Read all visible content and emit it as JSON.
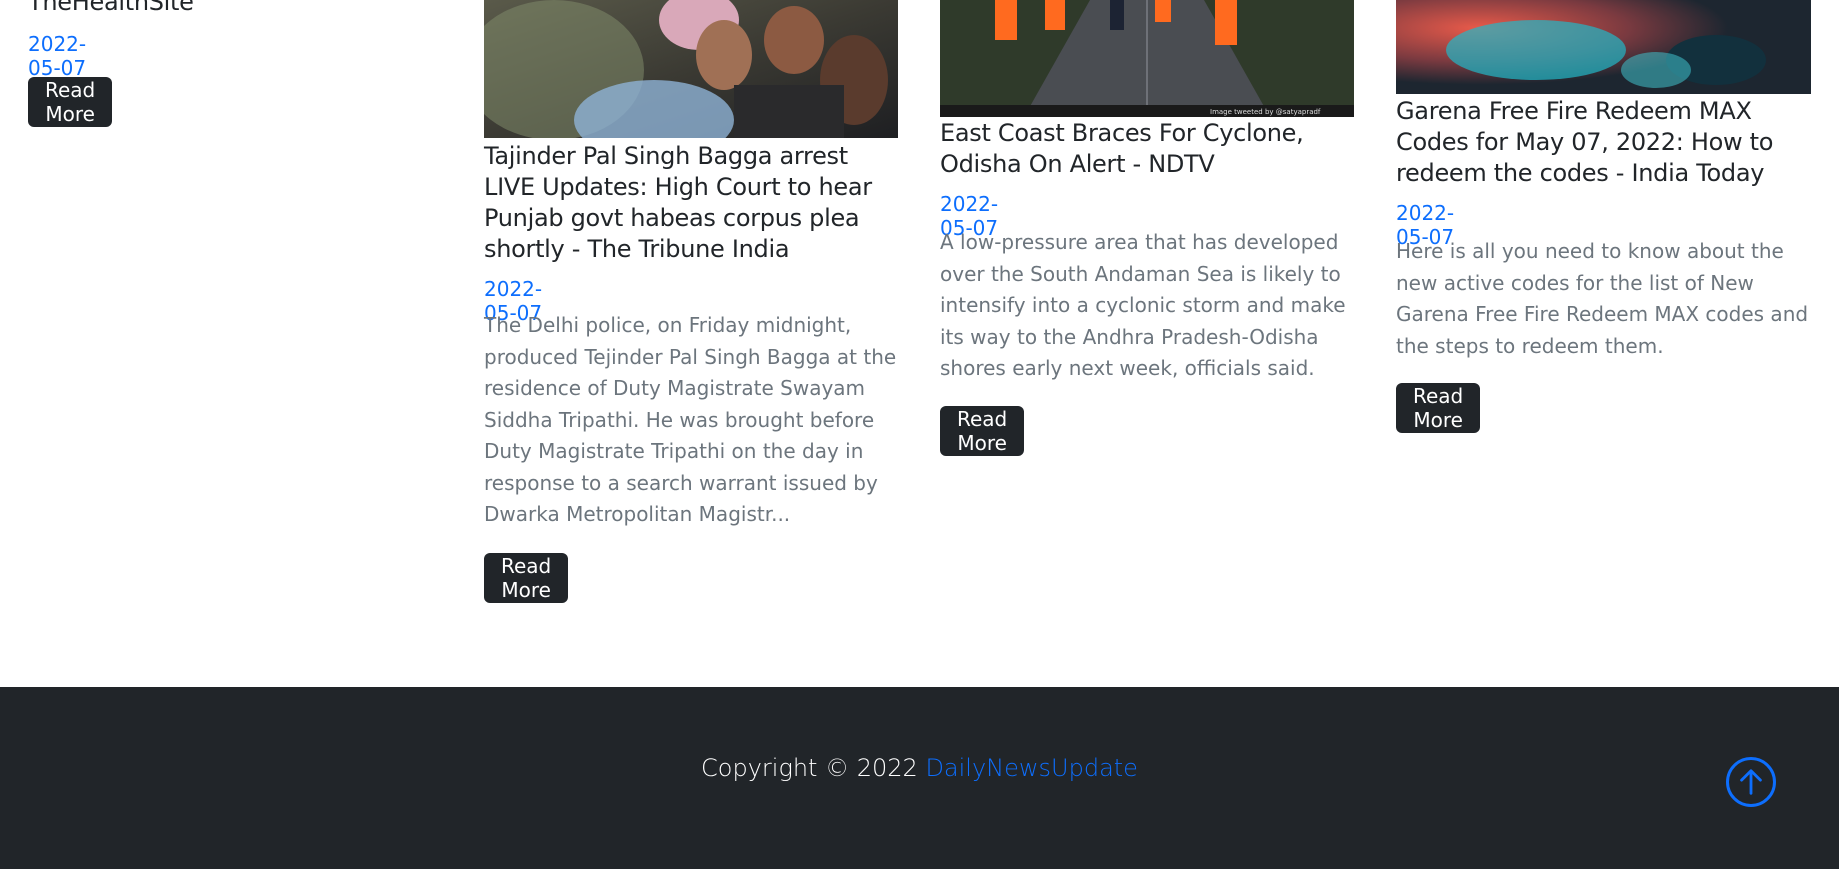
{
  "cards": [
    {
      "title": "TheHealthSite",
      "date": "2022-05-07",
      "button": "Read More"
    },
    {
      "title": "Tajinder Pal Singh Bagga arrest LIVE Updates: High Court to hear Punjab govt habeas corpus plea shortly - The Tribune India",
      "date": "2022-05-07",
      "description": "The Delhi police, on Friday midnight, produced Tejinder Pal Singh Bagga at the residence of Duty Magistrate Swayam Siddha Tripathi. He was brought before Duty Magistrate Tripathi on the day in response to a search warrant issued by Dwarka Metropolitan Magistr...",
      "button": "Read More"
    },
    {
      "title": "East Coast Braces For Cyclone, Odisha On Alert - NDTV",
      "date": "2022-05-07",
      "description": "A low-pressure area that has developed over the South Andaman Sea is likely to intensify into a cyclonic storm and make its way to the Andhra Pradesh-Odisha shores early next week, officials said.",
      "image_caption": "Image tweeted by @satyapradf",
      "button": "Read More"
    },
    {
      "title": "Garena Free Fire Redeem MAX Codes for May 07, 2022: How to redeem the codes - India Today",
      "date": "2022-05-07",
      "description": "Here is all you need to know about the new active codes for the list of New Garena Free Fire Redeem MAX codes and the steps to redeem them.",
      "button": "Read More"
    }
  ],
  "footer": {
    "copyright_prefix": "Copyright © 2022",
    "brand": "DailyNewsUpdate"
  },
  "scroll_top_icon": "arrow-up-circle-icon",
  "colors": {
    "accent": "#0d6efd",
    "dark": "#212529",
    "muted": "#6c757d"
  }
}
